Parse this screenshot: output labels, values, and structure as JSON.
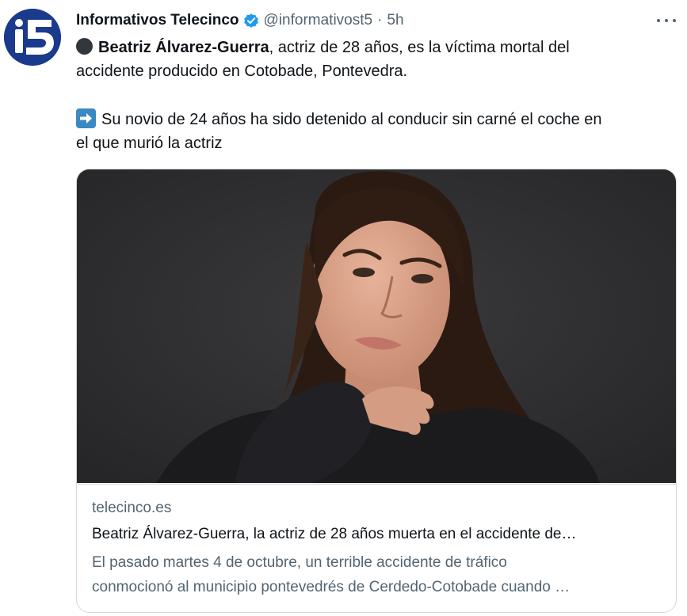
{
  "tweet": {
    "author": {
      "display_name": "Informativos Telecinco",
      "handle": "@informativost5",
      "separator": "·",
      "time": "5h",
      "verified": true,
      "avatar_icon": "telecinco-logo-icon"
    },
    "more_icon": "more-horizontal-icon",
    "text": {
      "p1_emoji": "black-circle-icon",
      "p1_bold": "Beatriz Álvarez-Guerra",
      "p1_line1_rest": ", actriz de 28 años, es la víctima mortal del",
      "p1_line2": "accidente producido en Cotobade, Pontevedra.",
      "p2_emoji": "right-arrow-icon",
      "p2_line1": "Su novio de 24 años ha sido detenido al conducir sin carné el coche en",
      "p2_line2": "el que murió la actriz"
    },
    "card": {
      "image_subject": "portrait-photo",
      "domain": "telecinco.es",
      "title": "Beatriz Álvarez-Guerra, la actriz de 28 años muerta en el accidente de…",
      "description_line1": "El pasado martes 4 de octubre, un terrible accidente de tráfico",
      "description_line2": "conmocionó al municipio pontevedrés de Cerdedo-Cotobade cuando …"
    }
  },
  "colors": {
    "text_primary": "#0f1419",
    "text_secondary": "#536471",
    "verified_blue": "#1d9bf0",
    "avatar_blue": "#1a3a8c",
    "card_border": "#cfd9de"
  }
}
